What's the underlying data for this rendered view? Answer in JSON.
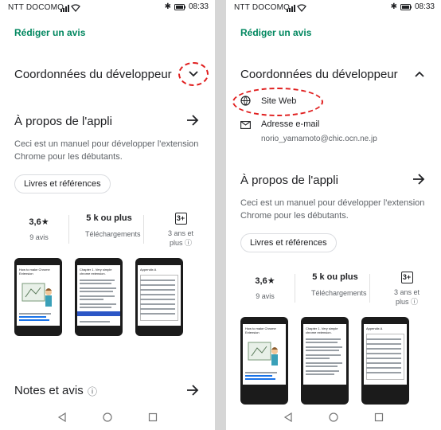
{
  "status": {
    "carrier": "NTT DOCOMO",
    "time": "08:33"
  },
  "left": {
    "write_review": "Rédiger un avis",
    "developer_section": "Coordonnées du développeur",
    "about_title": "À propos de l'appli",
    "description": "Ceci est un manuel pour développer l'extension Chrome pour les débutants.",
    "chip": "Livres et références",
    "stats": {
      "rating_value": "3,6★",
      "rating_label": "9 avis",
      "downloads_value": "5 k ou plus",
      "downloads_label": "Téléchargements",
      "age_badge": "3+",
      "age_label": "3 ans et plus ⓘ"
    },
    "reviews_title": "Notes et avis",
    "reviews_info": "ⓘ"
  },
  "right": {
    "write_review": "Rédiger un avis",
    "developer_section": "Coordonnées du développeur",
    "website": "Site Web",
    "email_label": "Adresse e-mail",
    "email_value": "norio_yamamoto@chic.ocn.ne.jp",
    "about_title": "À propos de l'appli",
    "description": "Ceci est un manuel pour développer l'extension Chrome pour les débutants.",
    "chip": "Livres et références",
    "stats": {
      "rating_value": "3,6★",
      "rating_label": "9 avis",
      "downloads_value": "5 k ou plus",
      "downloads_label": "Téléchargements",
      "age_badge": "3+",
      "age_label": "3 ans et plus ⓘ"
    }
  },
  "screenshots": [
    {
      "title": "How to make Chrome Extension"
    },
    {
      "title": "Chapter 1. Very simple chrome extension."
    },
    {
      "title": "Appendix A"
    }
  ],
  "colors": {
    "accent_green": "#01875f",
    "annotation_red": "#e01e1e",
    "divider_gray": "#d6d6d6"
  }
}
